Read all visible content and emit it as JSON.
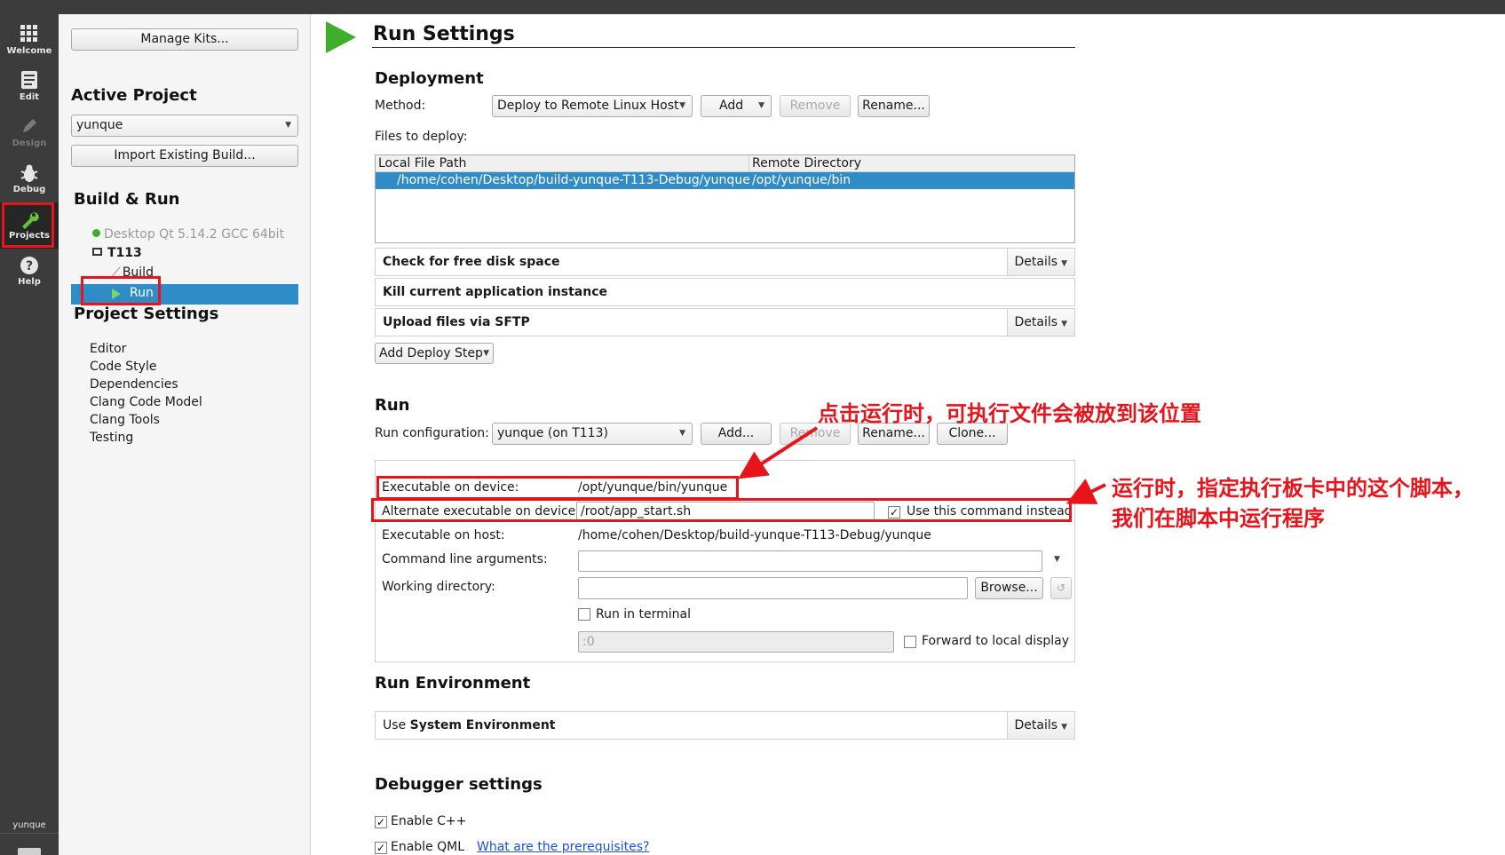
{
  "modebar": {
    "items": [
      {
        "label": "Welcome",
        "icon": "grid-icon"
      },
      {
        "label": "Edit",
        "icon": "document-icon"
      },
      {
        "label": "Design",
        "icon": "pencil-icon"
      },
      {
        "label": "Debug",
        "icon": "bug-icon"
      },
      {
        "label": "Projects",
        "icon": "wrench-icon"
      },
      {
        "label": "Help",
        "icon": "question-icon"
      }
    ],
    "project_name": "yunque"
  },
  "sidebar": {
    "manage_kits": "Manage Kits...",
    "active_project_heading": "Active Project",
    "active_project_value": "yunque",
    "import_build": "Import Existing Build...",
    "build_run_heading": "Build & Run",
    "kit_disabled": "Desktop Qt 5.14.2 GCC 64bit",
    "kit_active": "T113",
    "build_item": "Build",
    "run_item": "Run",
    "project_settings_heading": "Project Settings",
    "settings_items": [
      "Editor",
      "Code Style",
      "Dependencies",
      "Clang Code Model",
      "Clang Tools",
      "Testing"
    ]
  },
  "main": {
    "title": "Run Settings",
    "deployment": {
      "heading": "Deployment",
      "method_label": "Method:",
      "method_value": "Deploy to Remote Linux Host",
      "add": "Add",
      "remove": "Remove",
      "rename": "Rename...",
      "files_label": "Files to deploy:",
      "table": {
        "headers": [
          "Local File Path",
          "Remote Directory"
        ],
        "rows": [
          [
            "/home/cohen/Desktop/build-yunque-T113-Debug/yunque",
            "/opt/yunque/bin"
          ]
        ]
      },
      "steps": [
        {
          "title": "Check for free disk space",
          "details": "Details"
        },
        {
          "title": "Kill current application instance",
          "details": ""
        },
        {
          "title": "Upload files via SFTP",
          "details": "Details"
        }
      ],
      "add_step": "Add Deploy Step"
    },
    "run": {
      "heading": "Run",
      "config_label": "Run configuration:",
      "config_value": "yunque (on T113)",
      "add": "Add...",
      "remove": "Remove",
      "rename": "Rename...",
      "clone": "Clone...",
      "exec_device_label": "Executable on device:",
      "exec_device_value": "/opt/yunque/bin/yunque",
      "alt_exec_label": "Alternate executable on device:",
      "alt_exec_value": "/root/app_start.sh",
      "use_command_label": "Use this command instead",
      "exec_host_label": "Executable on host:",
      "exec_host_value": "/home/cohen/Desktop/build-yunque-T113-Debug/yunque",
      "args_label": "Command line arguments:",
      "workdir_label": "Working directory:",
      "browse": "Browse...",
      "run_terminal_label": "Run in terminal",
      "display_value": ":0",
      "forward_display_label": "Forward to local display"
    },
    "run_env": {
      "heading": "Run Environment",
      "use_prefix": "Use",
      "use_value": "System Environment",
      "details": "Details"
    },
    "debugger": {
      "heading": "Debugger settings",
      "enable_cpp": "Enable C++",
      "enable_qml": "Enable QML",
      "prereq_link": "What are the prerequisites?"
    }
  },
  "annotations": {
    "top": "点击运行时，可执行文件会被放到该位置",
    "right_line1": "运行时，指定执行板卡中的这个脚本，",
    "right_line2": "我们在脚本中运行程序"
  },
  "colors": {
    "accent_selection": "#308cc6",
    "annotation_red": "#e8141c",
    "modebar_bg": "#3c3c3c",
    "run_icon_green": "#3fae2a"
  }
}
